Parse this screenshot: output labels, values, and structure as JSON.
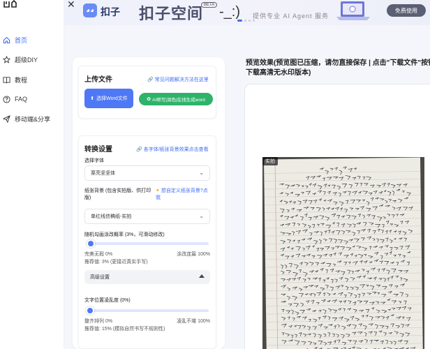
{
  "sidebar": {
    "items": [
      {
        "label": "首页",
        "icon": "home-icon",
        "active": true
      },
      {
        "label": "超级DIY",
        "icon": "star-icon",
        "active": false
      },
      {
        "label": "教程",
        "icon": "book-icon",
        "active": false
      },
      {
        "label": "FAQ",
        "icon": "help-icon",
        "active": false
      },
      {
        "label": "移动端&分享",
        "icon": "send-icon",
        "active": false
      }
    ]
  },
  "banner": {
    "logo_text": "扣子",
    "title": "扣子空间",
    "beta": "BETA",
    "smile": "-_:)",
    "subtitle": "提供专业 AI Agent 服务",
    "button": "免费使用"
  },
  "upload": {
    "title": "上传文件",
    "help_link": "常见问题解决方法在这里",
    "select_button": "选择Word文件",
    "ai_button": "AI帮写|润色|在线生成word"
  },
  "convert": {
    "title": "转换设置",
    "preview_link": "各字体/纸张背景效果点击查看",
    "font_label": "选择字体",
    "font_value": "栗亮坚坚体",
    "bg_label": "纸张背景 (包含实拍版、供打印版)",
    "custom_bg_link": "想自定义纸张背景?点我",
    "bg_value": "单红线信稿纸-实拍",
    "typo_label": "随机勾画涂改概率 (3%，可滑动修改)",
    "typo_min": "完美无瑕 0%",
    "typo_max": "涂改连篇 100%",
    "typo_recommend": "推荐值: 3% (更接近真实手写)",
    "typo_value": 3,
    "advanced_label": "高级设置",
    "pos_label": "文字位置凌乱度 (0%)",
    "pos_min": "整齐排列 0%",
    "pos_max": "凌乱不堪 100%",
    "pos_recommend": "推荐值: 15% (模拟自然书写不规则性)",
    "pos_value": 0
  },
  "preview": {
    "title_line1": "预览效果(预览图已压缩，请勿直接保存 | 点击\"下载文件\"按钮",
    "title_line2": "下载高清无水印版本)",
    "tag": "实拍"
  },
  "colors": {
    "accent": "#4f78f6",
    "green": "#2fb36a",
    "link": "#3d6cf5"
  }
}
